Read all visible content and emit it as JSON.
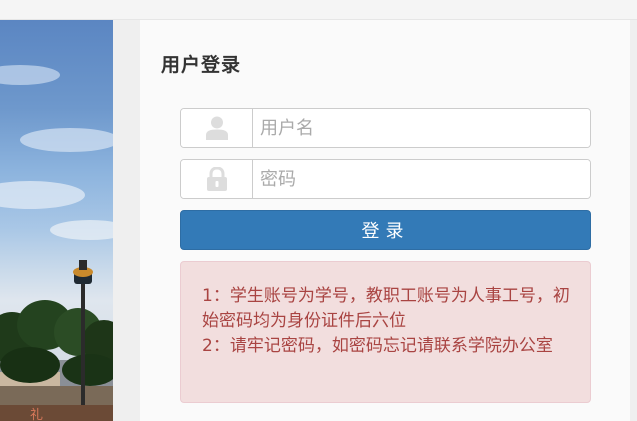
{
  "login": {
    "title": "用户登录",
    "username": {
      "icon": "user-icon",
      "placeholder": "用户名",
      "value": ""
    },
    "password": {
      "icon": "lock-icon",
      "placeholder": "密码",
      "value": ""
    },
    "submit_label": "登录",
    "notice": [
      "1：学生账号为学号，教职工账号为人事工号，初始密码均为身份证件后六位",
      "2：请牢记密码，如密码忘记请联系学院办公室"
    ]
  },
  "colors": {
    "button": "#337ab7",
    "alert_background": "#f2dede",
    "alert_text": "#a94442",
    "icon": "#dddddd"
  }
}
